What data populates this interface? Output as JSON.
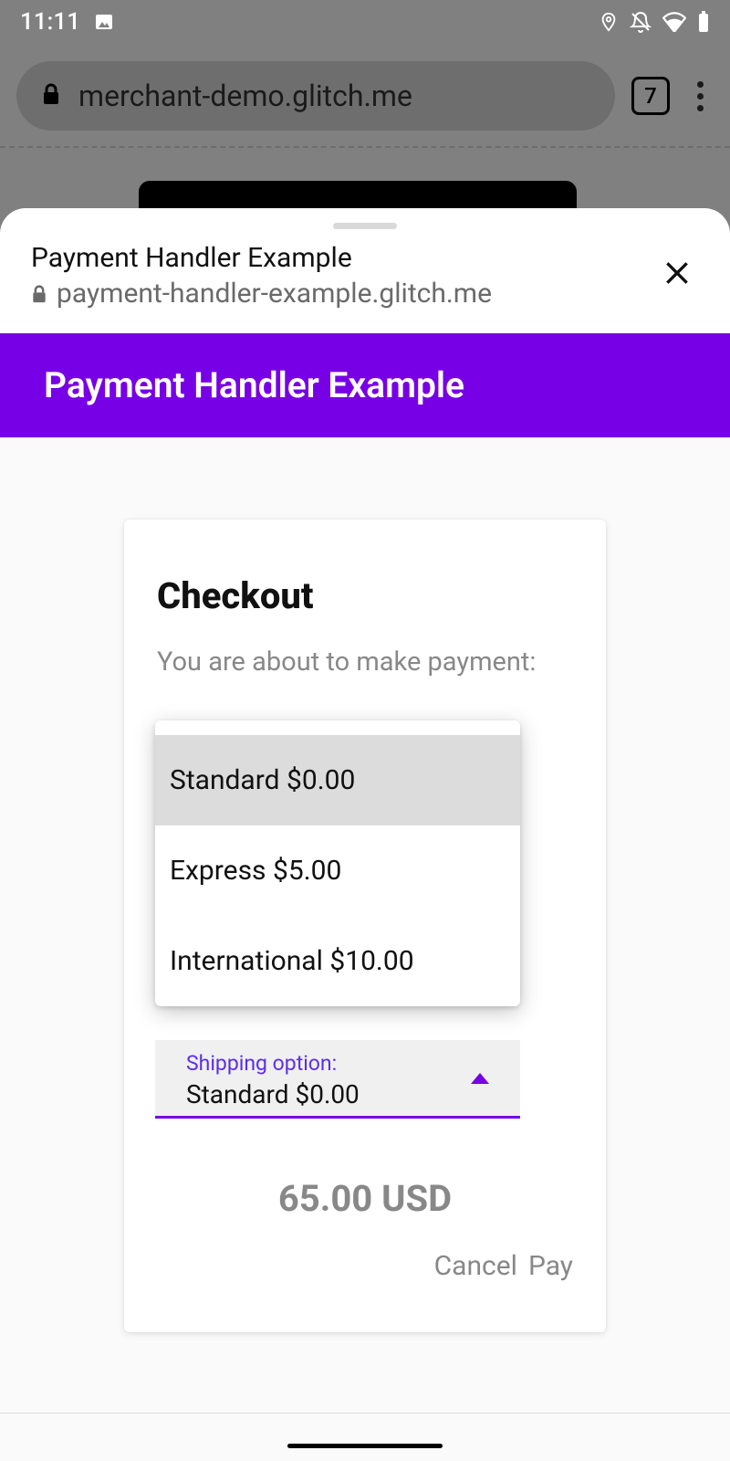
{
  "status": {
    "time": "11:11",
    "tab_count": "7"
  },
  "browser": {
    "url": "merchant-demo.glitch.me"
  },
  "sheet": {
    "title": "Payment Handler Example",
    "origin": "payment-handler-example.glitch.me",
    "banner": "Payment Handler Example"
  },
  "checkout": {
    "title": "Checkout",
    "subtitle": "You are about to make payment:",
    "shipping_label": "Shipping option:",
    "shipping_selected": "Standard $0.00",
    "shipping_options": [
      "Standard $0.00",
      "Express $5.00",
      "International $10.00"
    ],
    "total": "65.00 USD",
    "cancel_label": "Cancel",
    "pay_label": "Pay"
  }
}
